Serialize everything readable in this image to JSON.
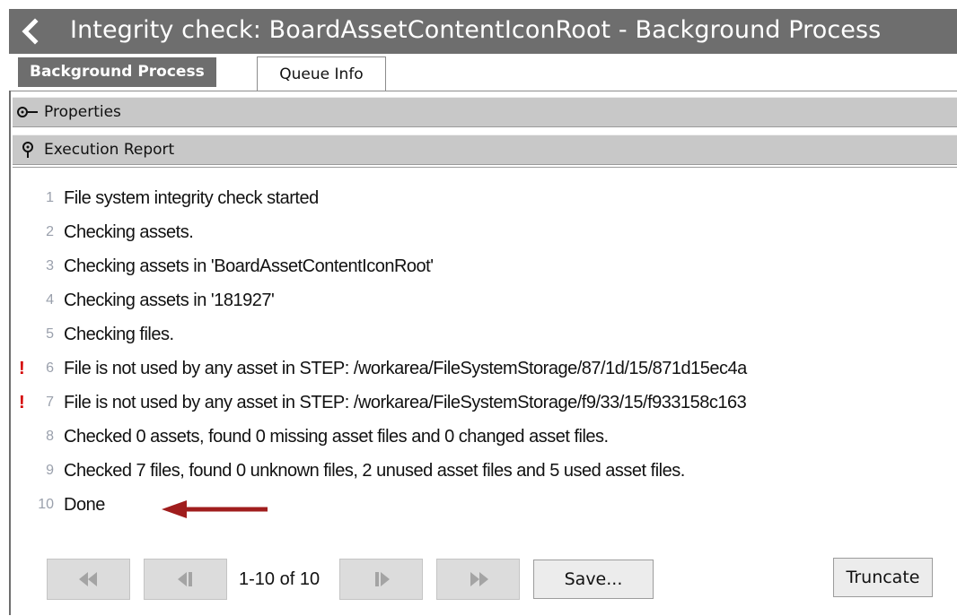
{
  "window": {
    "title": "Integrity check: BoardAssetContentIconRoot - Background Process"
  },
  "tabs": [
    {
      "label": "Background Process",
      "active": true
    },
    {
      "label": "Queue Info",
      "active": false
    }
  ],
  "sections": {
    "properties": {
      "label": "Properties",
      "icon": "expand-pin-icon"
    },
    "execution_report": {
      "label": "Execution Report",
      "icon": "pin-icon"
    }
  },
  "log": [
    {
      "n": "1",
      "text": "File system integrity check started",
      "warning": false
    },
    {
      "n": "2",
      "text": "Checking assets.",
      "warning": false
    },
    {
      "n": "3",
      "text": "Checking assets in 'BoardAssetContentIconRoot'",
      "warning": false
    },
    {
      "n": "4",
      "text": "Checking assets in '181927'",
      "warning": false
    },
    {
      "n": "5",
      "text": "Checking files.",
      "warning": false
    },
    {
      "n": "6",
      "text": "File is not used by any asset in STEP: /workarea/FileSystemStorage/87/1d/15/871d15ec4a",
      "warning": true
    },
    {
      "n": "7",
      "text": "File is not used by any asset in STEP: /workarea/FileSystemStorage/f9/33/15/f933158c163",
      "warning": true
    },
    {
      "n": "8",
      "text": "Checked 0 assets, found 0 missing asset files and 0 changed asset files.",
      "warning": false
    },
    {
      "n": "9",
      "text": "Checked 7 files, found 0 unknown files, 2 unused asset files and 5 used asset files.",
      "warning": false
    },
    {
      "n": "10",
      "text": "Done",
      "warning": false
    }
  ],
  "warning_mark": "!",
  "pager": {
    "info": "1-10 of 10",
    "save_label": "Save...",
    "truncate_label": "Truncate"
  },
  "colors": {
    "title_bar": "#6e6e6e",
    "section_bar": "#c8c8c8",
    "warning": "#d40000",
    "arrow": "#a01d1d"
  }
}
